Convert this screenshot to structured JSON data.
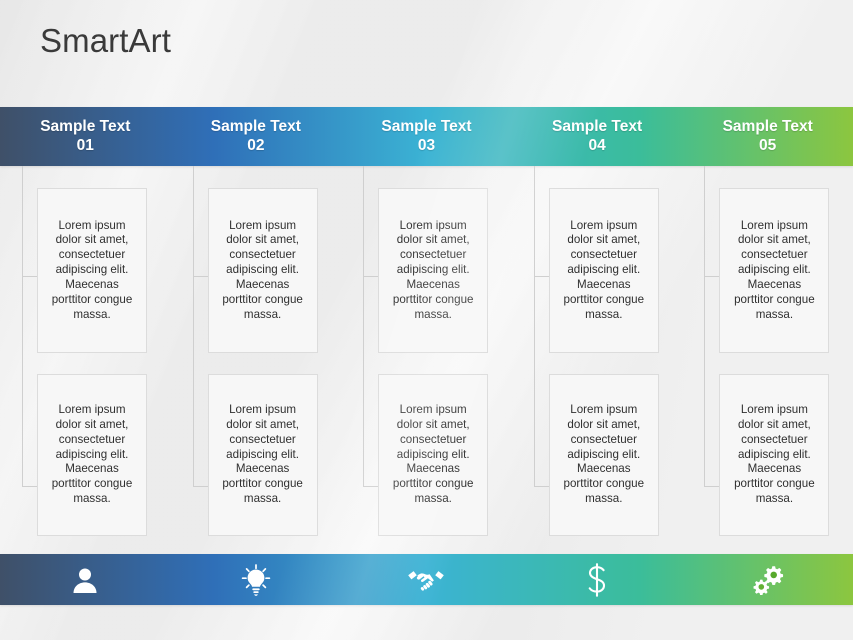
{
  "page_title": "SmartArt",
  "theme": {
    "gradient_stops": [
      "#3f5068",
      "#2f6fb8",
      "#3bb3d4",
      "#3bbd9a",
      "#8cc63f"
    ],
    "background": "#f0f0f0",
    "box_fill": "#f7f7f7",
    "box_border": "#dcdcdc",
    "connector": "#cfcfcf",
    "title_color": "#3a3a3a",
    "header_text_color": "#ffffff"
  },
  "body_text": "Lorem ipsum dolor sit amet, consectetuer adipiscing elit. Maecenas porttitor congue massa.",
  "columns": [
    {
      "header_label": "Sample Text",
      "header_number": "01",
      "icon": "person-icon",
      "boxes": [
        {
          "text": "Lorem ipsum dolor sit amet, consectetuer adipiscing elit. Maecenas porttitor congue massa."
        },
        {
          "text": "Lorem ipsum dolor sit amet, consectetuer adipiscing elit. Maecenas porttitor congue massa."
        }
      ]
    },
    {
      "header_label": "Sample Text",
      "header_number": "02",
      "icon": "lightbulb-icon",
      "boxes": [
        {
          "text": "Lorem ipsum dolor sit amet, consectetuer adipiscing elit. Maecenas porttitor congue massa."
        },
        {
          "text": "Lorem ipsum dolor sit amet, consectetuer adipiscing elit. Maecenas porttitor congue massa."
        }
      ]
    },
    {
      "header_label": "Sample Text",
      "header_number": "03",
      "icon": "handshake-icon",
      "boxes": [
        {
          "text": "Lorem ipsum dolor sit amet, consectetuer adipiscing elit. Maecenas porttitor congue massa."
        },
        {
          "text": "Lorem ipsum dolor sit amet, consectetuer adipiscing elit. Maecenas porttitor congue massa."
        }
      ]
    },
    {
      "header_label": "Sample Text",
      "header_number": "04",
      "icon": "dollar-icon",
      "boxes": [
        {
          "text": "Lorem ipsum dolor sit amet, consectetuer adipiscing elit. Maecenas porttitor congue massa."
        },
        {
          "text": "Lorem ipsum dolor sit amet, consectetuer adipiscing elit. Maecenas porttitor congue massa."
        }
      ]
    },
    {
      "header_label": "Sample Text",
      "header_number": "05",
      "icon": "gears-icon",
      "boxes": [
        {
          "text": "Lorem ipsum dolor sit amet, consectetuer adipiscing elit. Maecenas porttitor congue massa."
        },
        {
          "text": "Lorem ipsum dolor sit amet, consectetuer adipiscing elit. Maecenas porttitor congue massa."
        }
      ]
    }
  ]
}
